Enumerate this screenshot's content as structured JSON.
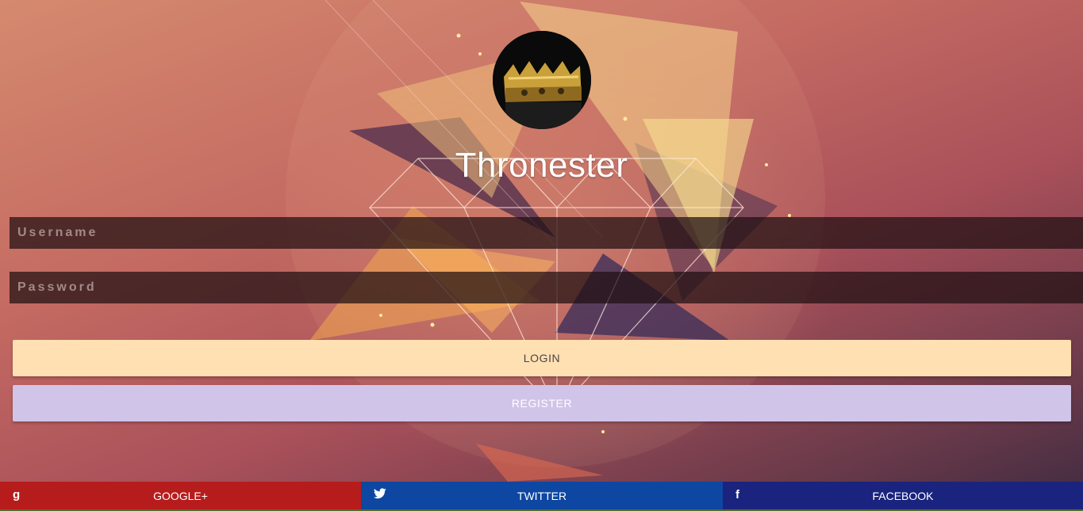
{
  "app": {
    "title": "Thronester"
  },
  "form": {
    "username_placeholder": "Username",
    "password_placeholder": "Password",
    "login_label": "LOGIN",
    "register_label": "REGISTER"
  },
  "social": {
    "google_label": "GOOGLE+",
    "google_icon": "g",
    "twitter_label": "TWITTER",
    "facebook_label": "FACEBOOK",
    "facebook_icon": "f"
  },
  "colors": {
    "login_button": "#ffe0b2",
    "register_button": "#d1c4e9",
    "google": "#b71c1c",
    "twitter": "#0d47a1",
    "facebook": "#1a237e"
  },
  "icons": [
    "crown-avatar",
    "google-plus-icon",
    "twitter-icon",
    "facebook-icon"
  ]
}
